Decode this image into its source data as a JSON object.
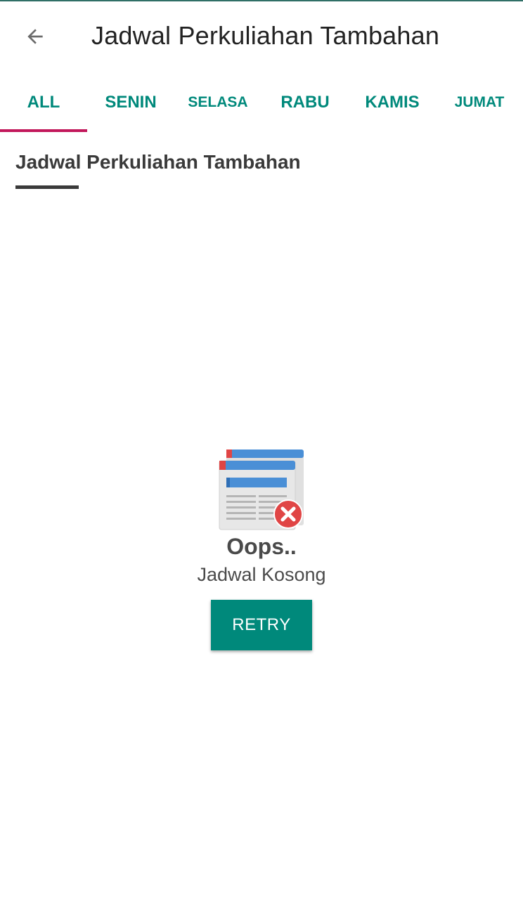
{
  "appbar": {
    "title": "Jadwal Perkuliahan Tambahan",
    "back_icon": "arrow-back-icon"
  },
  "tabs": [
    {
      "label": "ALL",
      "selected": true
    },
    {
      "label": "SENIN",
      "selected": false
    },
    {
      "label": "SELASA",
      "selected": false
    },
    {
      "label": "RABU",
      "selected": false
    },
    {
      "label": "KAMIS",
      "selected": false
    },
    {
      "label": "JUMAT",
      "selected": false
    }
  ],
  "section": {
    "title": "Jadwal Perkuliahan Tambahan"
  },
  "empty_state": {
    "icon": "empty-schedule-icon",
    "title": "Oops..",
    "subtitle": "Jadwal Kosong",
    "retry_label": "RETRY"
  },
  "colors": {
    "accent": "#00897b",
    "tab_indicator": "#c2185b",
    "text_dark": "#222222"
  }
}
